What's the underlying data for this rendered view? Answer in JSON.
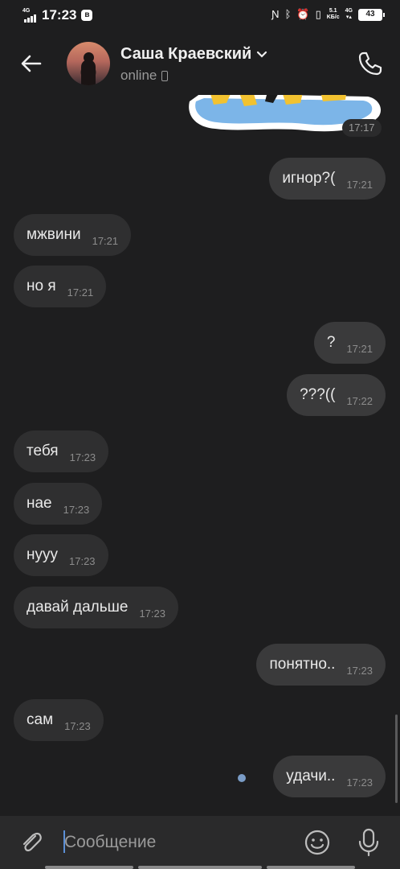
{
  "status_bar": {
    "network_label": "4G",
    "time": "17:23",
    "speed_value": "5.1",
    "speed_unit": "KБ/c",
    "network_label_2": "4G",
    "battery": "43"
  },
  "header": {
    "contact_name": "Саша Краевский",
    "status": "online"
  },
  "sticker": {
    "time": "17:17"
  },
  "messages": [
    {
      "text": "игнор?(",
      "time": "17:21",
      "direction": "out"
    },
    {
      "text": "мжвини",
      "time": "17:21",
      "direction": "in"
    },
    {
      "text": "но я",
      "time": "17:21",
      "direction": "in"
    },
    {
      "text": "?",
      "time": "17:21",
      "direction": "out"
    },
    {
      "text": "???((",
      "time": "17:22",
      "direction": "out"
    },
    {
      "text": "тебя",
      "time": "17:23",
      "direction": "in"
    },
    {
      "text": "нае",
      "time": "17:23",
      "direction": "in"
    },
    {
      "text": "нууу",
      "time": "17:23",
      "direction": "in"
    },
    {
      "text": "давай дальше",
      "time": "17:23",
      "direction": "in"
    },
    {
      "text": "понятно..",
      "time": "17:23",
      "direction": "out"
    },
    {
      "text": "сам",
      "time": "17:23",
      "direction": "in"
    },
    {
      "text": "удачи..",
      "time": "17:23",
      "direction": "out",
      "unread": true
    }
  ],
  "composer": {
    "placeholder": "Сообщение"
  },
  "colors": {
    "background": "#1e1e1f",
    "bubble_in": "#2f2f30",
    "bubble_out": "#3a3a3b",
    "accent": "#5b8fd6",
    "unread_dot": "#7a9cc6"
  }
}
